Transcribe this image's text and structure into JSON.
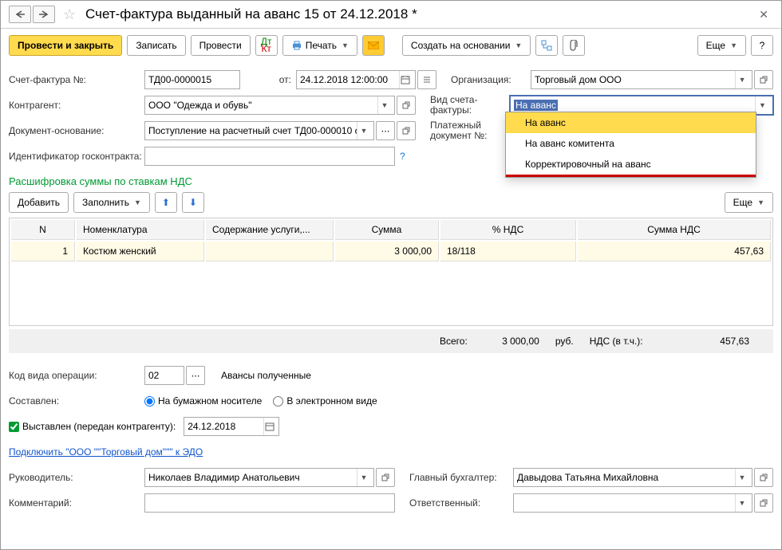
{
  "title": "Счет-фактура выданный на аванс 15 от 24.12.2018 *",
  "toolbar": {
    "post_close": "Провести и закрыть",
    "write": "Записать",
    "post": "Провести",
    "print": "Печать",
    "create_based": "Создать на основании",
    "more": "Еще"
  },
  "labels": {
    "number": "Счет-фактура №:",
    "from": "от:",
    "org": "Организация:",
    "contragent": "Контрагент:",
    "type": "Вид счета-фактуры:",
    "basis": "Документ-основание:",
    "paydoc": "Платежный документ №:",
    "gov_id": "Идентификатор госконтракта:",
    "op_code": "Код вида операции:",
    "composed": "Составлен:",
    "issued": "Выставлен (передан контрагенту):",
    "head": "Руководитель:",
    "accountant": "Главный бухгалтер:",
    "comment": "Комментарий:",
    "responsible": "Ответственный:"
  },
  "fields": {
    "number": "ТД00-0000015",
    "date": "24.12.2018 12:00:00",
    "org": "Торговый дом ООО",
    "contragent": "ООО \"Одежда и обувь\"",
    "type_selected": "На аванс",
    "basis": "Поступление на расчетный счет ТД00-000010 о",
    "op_code": "02",
    "op_code_desc": "Авансы полученные",
    "radio_paper": "На бумажном носителе",
    "radio_electronic": "В электронном виде",
    "issued_date": "24.12.2018",
    "head": "Николаев Владимир Анатольевич",
    "accountant": "Давыдова Татьяна Михайловна"
  },
  "dropdown": {
    "items": [
      "На аванс",
      "На аванс комитента",
      "Корректировочный на аванс"
    ]
  },
  "section_title": "Расшифровка суммы по ставкам НДС",
  "subtoolbar": {
    "add": "Добавить",
    "fill": "Заполнить",
    "more": "Еще"
  },
  "columns": {
    "n": "N",
    "nomen": "Номенклатура",
    "content": "Содержание услуги,...",
    "sum": "Сумма",
    "vat_pct": "% НДС",
    "vat_sum": "Сумма НДС"
  },
  "table_rows": [
    {
      "n": "1",
      "nomen": "Костюм женский",
      "content": "",
      "sum": "3 000,00",
      "vat_pct": "18/118",
      "vat_sum": "457,63"
    }
  ],
  "totals": {
    "label": "Всего:",
    "sum": "3 000,00",
    "currency": "руб.",
    "vat_label": "НДС (в т.ч.):",
    "vat_sum": "457,63"
  },
  "edo_link": "Подключить \"ООО \"\"Торговый дом\"\"\" к ЭДО"
}
